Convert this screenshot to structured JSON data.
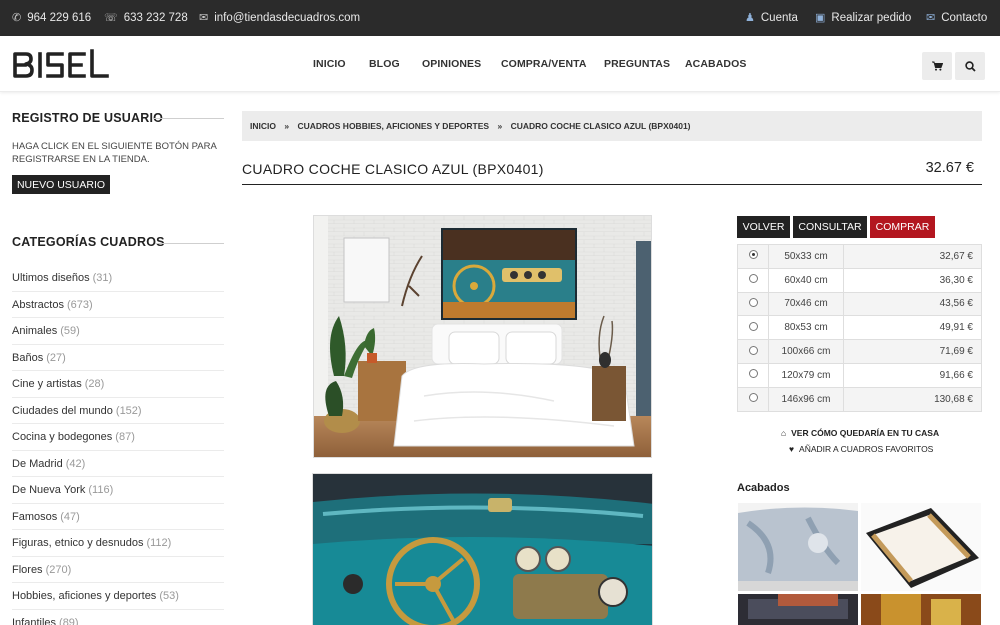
{
  "topbar": {
    "phone1": "964 229 616",
    "phone2": "633 232 728",
    "email": "info@tiendasdecuadros.com",
    "account": "Cuenta",
    "order": "Realizar pedido",
    "contact": "Contacto"
  },
  "header": {
    "logo": "BISEL",
    "nav": [
      "INICIO",
      "BLOG",
      "OPINIONES",
      "COMPRA/VENTA",
      "PREGUNTAS",
      "ACABADOS"
    ]
  },
  "sidebar": {
    "register_title": "REGISTRO DE USUARIO",
    "register_text": "HAGA CLICK EN EL SIGUIENTE BOTÓN PARA REGISTRARSE EN LA TIENDA.",
    "register_button": "NUEVO USUARIO",
    "categories_title": "CATEGORÍAS CUADROS",
    "categories": [
      {
        "name": "Ultimos diseños",
        "count": "(31)"
      },
      {
        "name": "Abstractos",
        "count": "(673)"
      },
      {
        "name": "Animales",
        "count": "(59)"
      },
      {
        "name": "Baños",
        "count": "(27)"
      },
      {
        "name": "Cine y artistas",
        "count": "(28)"
      },
      {
        "name": "Ciudades del mundo",
        "count": "(152)"
      },
      {
        "name": "Cocina y bodegones",
        "count": "(87)"
      },
      {
        "name": "De Madrid",
        "count": "(42)"
      },
      {
        "name": "De Nueva York",
        "count": "(116)"
      },
      {
        "name": "Famosos",
        "count": "(47)"
      },
      {
        "name": "Figuras, etnico y desnudos",
        "count": "(112)"
      },
      {
        "name": "Flores",
        "count": "(270)"
      },
      {
        "name": "Hobbies, aficiones y deportes",
        "count": "(53)"
      },
      {
        "name": "Infantiles",
        "count": "(89)"
      }
    ]
  },
  "breadcrumb": {
    "home": "INICIO",
    "sep": "»",
    "category": "CUADROS HOBBIES, AFICIONES Y DEPORTES",
    "product": "CUADRO COCHE CLASICO AZUL (BPX0401)"
  },
  "product": {
    "title": "CUADRO COCHE CLASICO AZUL (BPX0401)",
    "price": "32.67 €",
    "buttons": {
      "back": "VOLVER",
      "consult": "CONSULTAR",
      "buy": "COMPRAR"
    },
    "sizes": [
      {
        "size": "50x33 cm",
        "price": "32,67 €",
        "selected": true
      },
      {
        "size": "60x40 cm",
        "price": "36,30 €",
        "selected": false
      },
      {
        "size": "70x46 cm",
        "price": "43,56 €",
        "selected": false
      },
      {
        "size": "80x53 cm",
        "price": "49,91 €",
        "selected": false
      },
      {
        "size": "100x66 cm",
        "price": "71,69 €",
        "selected": false
      },
      {
        "size": "120x79 cm",
        "price": "91,66 €",
        "selected": false
      },
      {
        "size": "146x96 cm",
        "price": "130,68 €",
        "selected": false
      }
    ],
    "view_home": "VER CÓMO QUEDARÍA EN TU CASA",
    "add_favorites": "AÑADIR A CUADROS FAVORITOS",
    "finishes_title": "Acabados"
  },
  "colors": {
    "topbar": "#2b2b2b",
    "buy_button": "#b3161f",
    "dark_button": "#222222",
    "accent_icon": "#8fb1d9"
  }
}
